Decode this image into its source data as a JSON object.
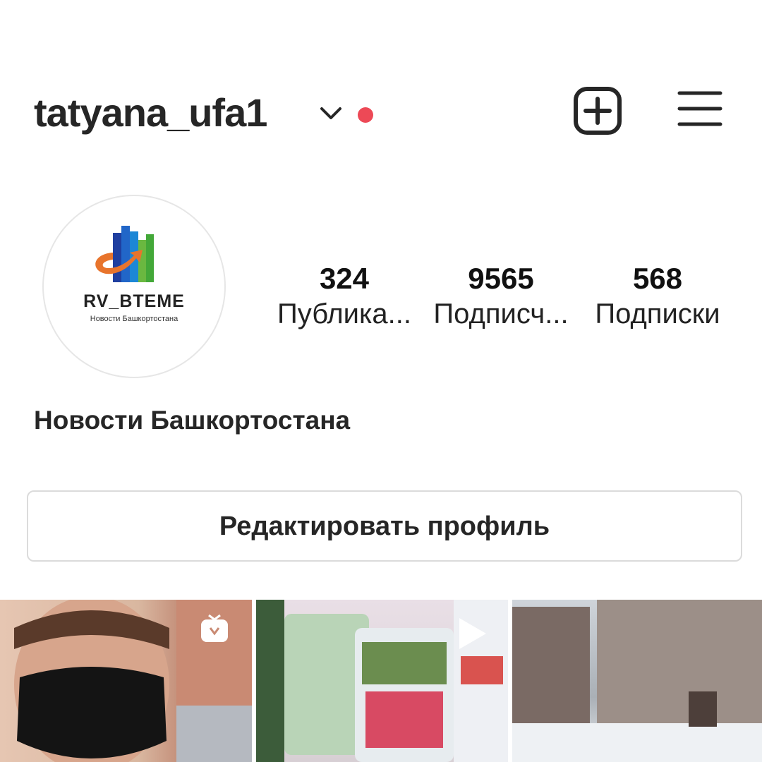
{
  "header": {
    "username": "tatyana_ufa1",
    "icons": [
      "chevron-down-icon",
      "notification-dot",
      "new-post-icon",
      "menu-icon"
    ],
    "dot_color": "#ed4956"
  },
  "profile": {
    "avatar": {
      "brand": "RV_BTEME",
      "subtitle": "Новости Башкортостана"
    },
    "stats": [
      {
        "value": "324",
        "label": "Публика..."
      },
      {
        "value": "9565",
        "label": "Подписч..."
      },
      {
        "value": "568",
        "label": "Подписки"
      }
    ],
    "bio_name": "Новости Башкортостана",
    "edit_button": "Редактировать профиль"
  },
  "posts": [
    {
      "type": "igtv",
      "icon": "igtv-icon"
    },
    {
      "type": "video",
      "icon": "play-icon"
    },
    {
      "type": "photo"
    }
  ]
}
